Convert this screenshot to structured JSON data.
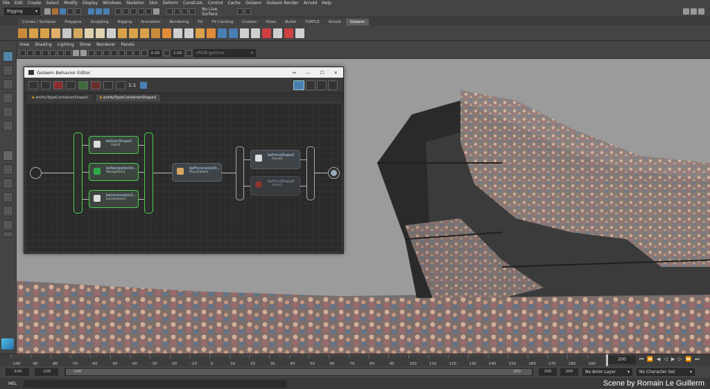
{
  "menu": [
    "File",
    "Edit",
    "Create",
    "Select",
    "Modify",
    "Display",
    "Windows",
    "Skeleton",
    "Skin",
    "Deform",
    "Constrain",
    "Control",
    "Cache",
    "Golaem",
    "Golaem Render",
    "Arnold",
    "Help"
  ],
  "status": {
    "mode": "Rigging",
    "live_surface": "No Live Surface"
  },
  "shelf_tabs": [
    "Curves / Surfaces",
    "Polygons",
    "Sculpting",
    "Rigging",
    "Animation",
    "Rendering",
    "FX",
    "FX Caching",
    "Custom",
    "XGen",
    "Bullet",
    "TURTLE",
    "Arnold",
    "Golaem"
  ],
  "shelf_active": "Golaem",
  "panel_menu": [
    "View",
    "Shading",
    "Lighting",
    "Show",
    "Renderer",
    "Panels"
  ],
  "panel_toolbar": {
    "field1": "0.00",
    "field2": "2.00",
    "colorspace": "sRGB gamma"
  },
  "behavior_editor": {
    "title": "Golaem Behavior Editor",
    "ratio_label": "1:1",
    "tabs": [
      "entityTypeContainerShape1",
      "entityTypeContainerShape2"
    ],
    "active_tab": "entityTypeContainerShape2",
    "nodes": [
      {
        "name": "beGotoShape2",
        "sub": "Goto1",
        "active": true
      },
      {
        "name": "beNavigationSh...",
        "sub": "Navigation1",
        "active": true
      },
      {
        "name": "beLocomotionS...",
        "sub": "Locomotion1",
        "active": true
      },
      {
        "name": "bePhysicalizeSh...",
        "sub": "Physicalize1",
        "active": false
      },
      {
        "name": "beForceShape3",
        "sub": "Force2",
        "active": false
      },
      {
        "name": "beForceShape6",
        "sub": "Force1",
        "active": false
      }
    ]
  },
  "timeline": {
    "ticks": [
      "-100",
      "-90",
      "-80",
      "-70",
      "-60",
      "-50",
      "-40",
      "-30",
      "-20",
      "-10",
      "0",
      "10",
      "20",
      "30",
      "40",
      "50",
      "60",
      "70",
      "80",
      "90",
      "100",
      "110",
      "120",
      "130",
      "140",
      "150",
      "160",
      "170",
      "180",
      "190",
      "200"
    ],
    "current_frame": "200",
    "frame_field": "200"
  },
  "range": {
    "start": "-100",
    "anim_start": "-100",
    "slider_start": "-100",
    "slider_end": "200",
    "anim_end": "200",
    "end": "200",
    "anim_layer": "No Anim Layer",
    "character_set": "No Character Set"
  },
  "cmdline": {
    "label": "MEL"
  },
  "credit": "Scene by Romain Le Guillerm",
  "colors": {
    "accent_green": "#49d24a",
    "viewport_bg": "#9b9b9b",
    "ui_bg": "#444444"
  }
}
